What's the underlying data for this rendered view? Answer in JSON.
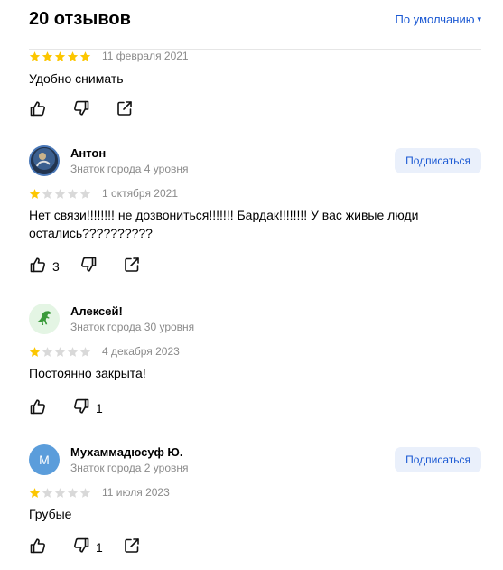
{
  "header": {
    "count_title": "20 отзывов",
    "sort_label": "По умолчанию",
    "sort_caret": "▾"
  },
  "colors": {
    "star_filled": "#fcc600",
    "star_empty": "#d9d9d9",
    "link": "#1b59d3",
    "subscribe_bg": "#eaf0fb"
  },
  "reviews": [
    {
      "rating": 5,
      "date": "11 февраля 2021",
      "text": "Удобно снимать",
      "likes": "",
      "dislikes": ""
    },
    {
      "name": "Антон",
      "level": "Знаток города 4 уровня",
      "subscribe_label": "Подписаться",
      "avatar_icon": "photo-avatar-icon",
      "rating": 1,
      "date": "1 октября 2021",
      "text": "Нет связи!!!!!!!! не дозвониться!!!!!!! Бардак!!!!!!!! У вас живые люди остались??????????",
      "likes": "3",
      "dislikes": ""
    },
    {
      "name": "Алексей!",
      "level": "Знаток города 30 уровня",
      "avatar_icon": "dinosaur-icon",
      "rating": 1,
      "date": "4 декабря 2023",
      "text": "Постоянно закрыта!",
      "likes": "",
      "dislikes": "1"
    },
    {
      "name": "Мухаммадюсуф Ю.",
      "level": "Знаток города 2 уровня",
      "subscribe_label": "Подписаться",
      "avatar_letter": "М",
      "avatar_color": "#5b9ddb",
      "rating": 1,
      "date": "11 июля 2023",
      "text": "Грубые",
      "likes": "",
      "dislikes": "1"
    }
  ]
}
